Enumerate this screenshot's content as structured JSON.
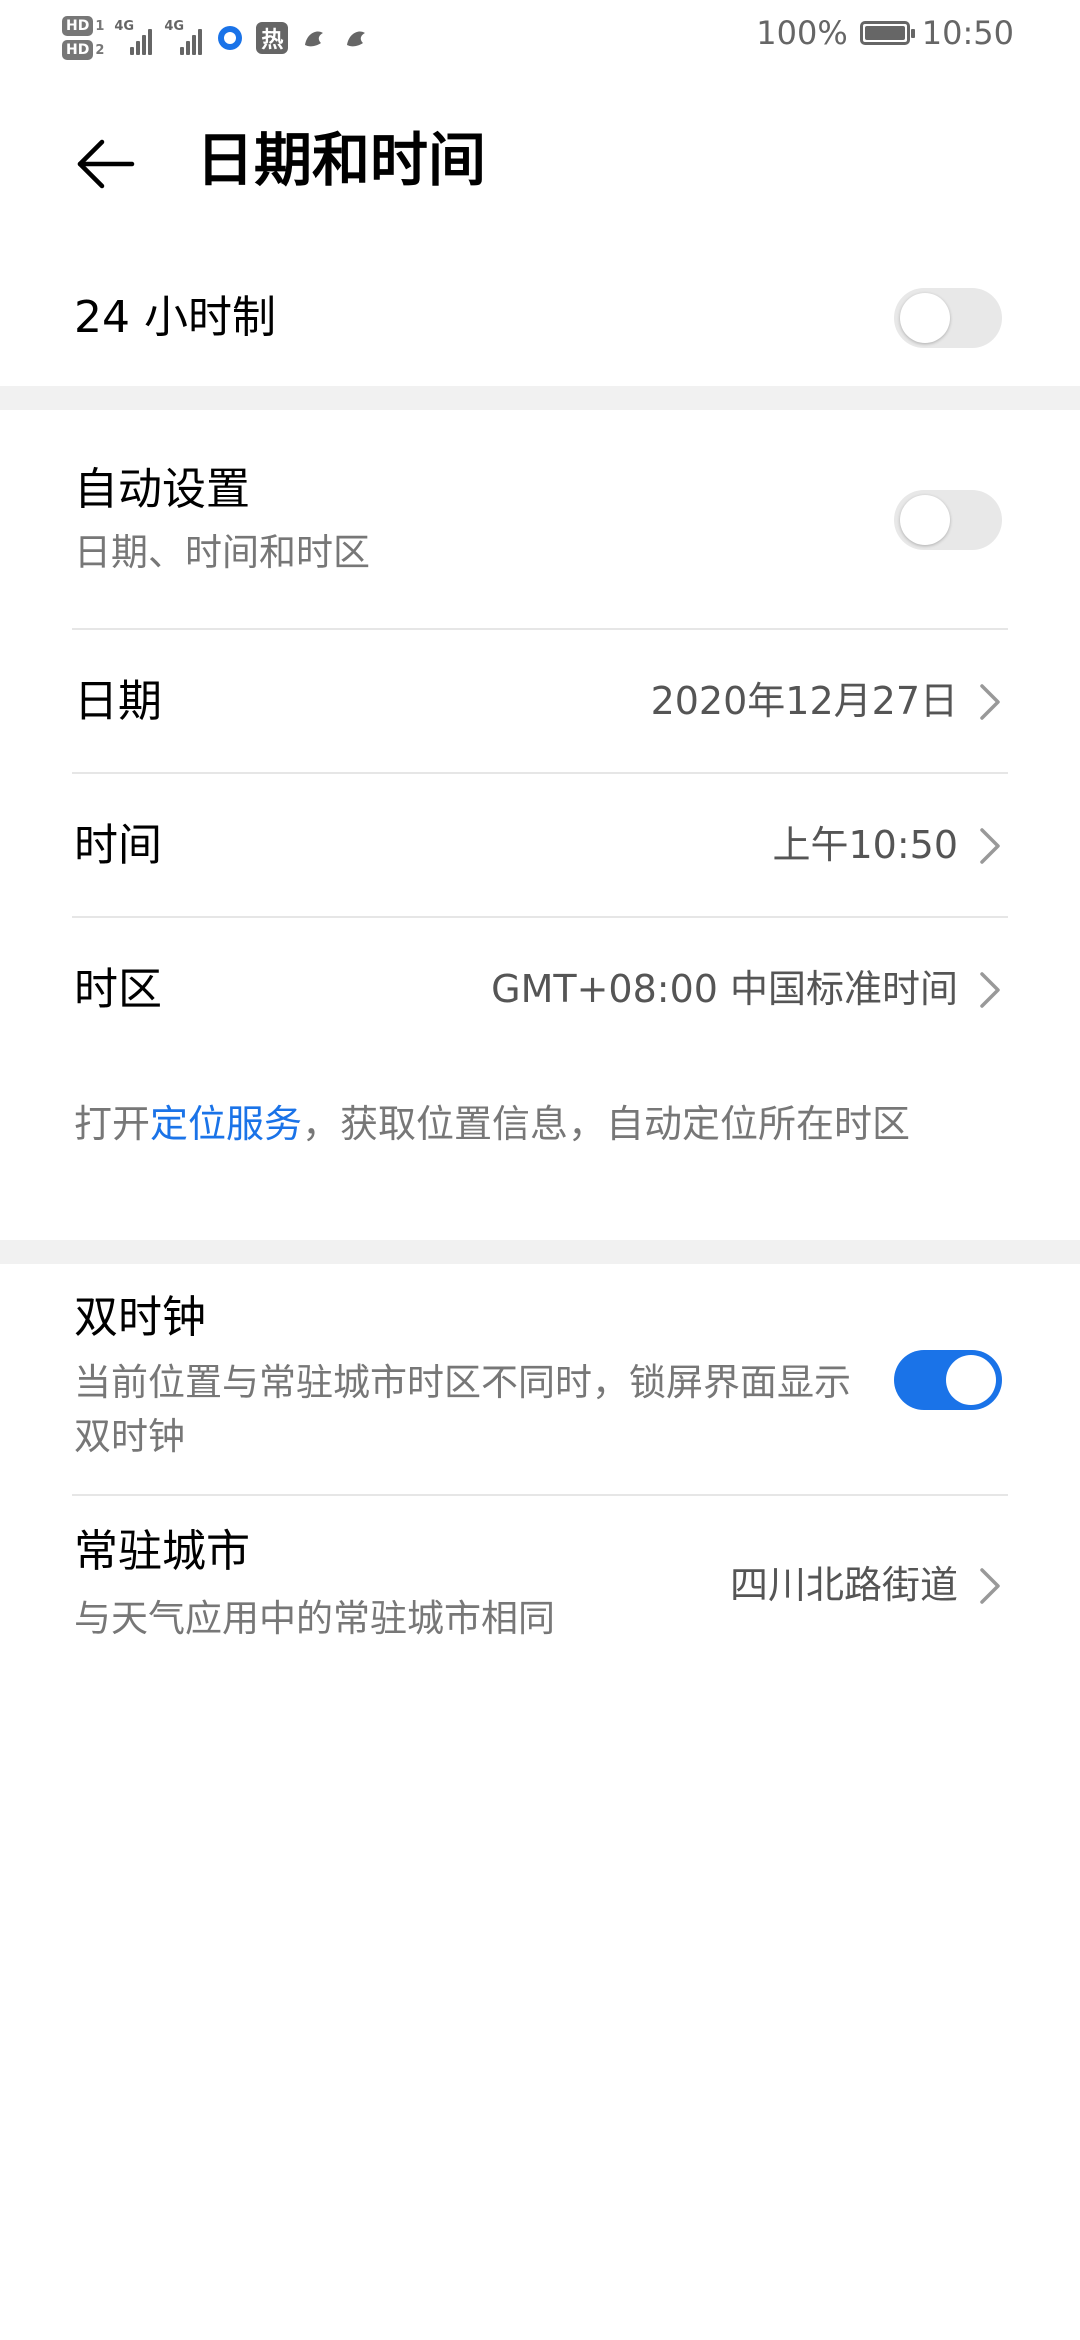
{
  "status_bar": {
    "hd1_label": "HD",
    "hd1_num": "1",
    "hd2_label": "HD",
    "hd2_num": "2",
    "sig1_tag": "4G",
    "sig2_tag": "4G",
    "hot_label": "热",
    "battery_percent_text": "100%",
    "battery_level": 1.0,
    "time": "10:50"
  },
  "header": {
    "title": "日期和时间"
  },
  "settings": {
    "hour24": {
      "label": "24 小时制",
      "enabled": false
    },
    "auto": {
      "label": "自动设置",
      "sub": "日期、时间和时区",
      "enabled": false
    },
    "date": {
      "label": "日期",
      "value": "2020年12月27日"
    },
    "time": {
      "label": "时间",
      "value": "上午10:50"
    },
    "timezone": {
      "label": "时区",
      "value": "GMT+08:00 中国标准时间"
    },
    "location_note": {
      "prefix": "打开",
      "link": "定位服务",
      "suffix": "，获取位置信息，自动定位所在时区"
    },
    "dual_clock": {
      "label": "双时钟",
      "sub": "当前位置与常驻城市时区不同时，锁屏界面显示双时钟",
      "enabled": true
    },
    "home_city": {
      "label": "常驻城市",
      "sub": "与天气应用中的常驻城市相同",
      "value": "四川北路街道"
    }
  },
  "colors": {
    "accent": "#1a73e8",
    "toggle_off": "#e8e8e8",
    "section_gap": "#f1f1f1"
  }
}
